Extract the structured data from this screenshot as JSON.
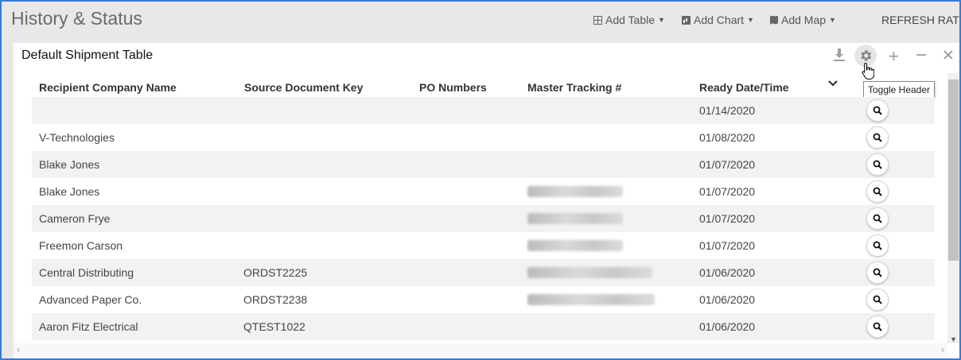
{
  "header": {
    "title": "History & Status",
    "add_table": "Add Table",
    "add_chart": "Add Chart",
    "add_map": "Add Map",
    "refresh_rate": "REFRESH RATE"
  },
  "panel": {
    "title": "Default Shipment Table",
    "tooltip": "Toggle Header"
  },
  "table": {
    "columns": [
      "Recipient Company Name",
      "Source Document Key",
      "PO Numbers",
      "Master Tracking #",
      "Ready Date/Time"
    ],
    "rows": [
      {
        "company": "",
        "source_key": "",
        "po": "",
        "date": "01/14/2020"
      },
      {
        "company": "V-Technologies",
        "source_key": "",
        "po": "",
        "date": "01/08/2020"
      },
      {
        "company": "Blake Jones",
        "source_key": "",
        "po": "",
        "date": "01/07/2020"
      },
      {
        "company": "Blake Jones",
        "source_key": "",
        "po": "",
        "date": "01/07/2020"
      },
      {
        "company": "Cameron Frye",
        "source_key": "",
        "po": "",
        "date": "01/07/2020"
      },
      {
        "company": "Freemon Carson",
        "source_key": "",
        "po": "",
        "date": "01/07/2020"
      },
      {
        "company": "Central Distributing",
        "source_key": "ORDST2225",
        "po": "",
        "date": "01/06/2020"
      },
      {
        "company": "Advanced Paper Co.",
        "source_key": "ORDST2238",
        "po": "",
        "date": "01/06/2020"
      },
      {
        "company": "Aaron Fitz Electrical",
        "source_key": "QTEST1022",
        "po": "",
        "date": "01/06/2020"
      }
    ]
  }
}
